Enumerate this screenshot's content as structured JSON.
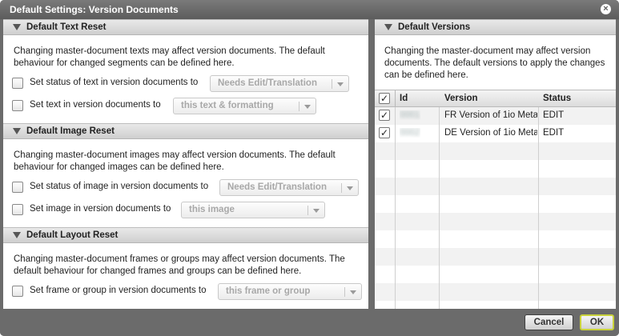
{
  "dialog": {
    "title": "Default Settings: Version Documents"
  },
  "text_reset": {
    "header": "Default Text Reset",
    "description_1": "Changing master-document texts may affect version documents. The default",
    "description_2": "behaviour for changed segments can be defined here.",
    "row1_label": "Set status of text in version documents to",
    "row1_value": "Needs Edit/Translation",
    "row2_label": "Set text in version documents to",
    "row2_value": "this text & formatting"
  },
  "image_reset": {
    "header": "Default Image Reset",
    "description_1": "Changing master-document images may affect version documents. The default",
    "description_2": "behaviour for changed images can be defined here.",
    "row1_label": "Set status of image in version documents to",
    "row1_value": "Needs Edit/Translation",
    "row2_label": "Set image in version documents to",
    "row2_value": "this image"
  },
  "layout_reset": {
    "header": "Default Layout Reset",
    "description_1": "Changing master-document frames or groups may affect version documents. The",
    "description_2": "default behaviour for changed frames and groups can be defined here.",
    "row1_label": "Set frame or group in version documents to",
    "row1_value": "this frame or group"
  },
  "versions": {
    "header": "Default Versions",
    "description_1": "Changing the master-document may affect version",
    "description_2": "documents. The default versions to apply the changes",
    "description_3": "can be defined here.",
    "columns": {
      "id": "Id",
      "version": "Version",
      "status": "Status"
    },
    "rows": [
      {
        "id": "0001",
        "version": "FR Version of 1io Meta",
        "status": "EDIT",
        "checked": true
      },
      {
        "id": "0002",
        "version": "DE Version of 1io Meta",
        "status": "EDIT",
        "checked": true
      }
    ]
  },
  "footer": {
    "cancel_label": "Cancel",
    "ok_label": "OK"
  },
  "icons": {
    "close": "close-icon",
    "collapse": "triangle-down-icon",
    "dropdown": "chevron-down-icon",
    "check": "✓"
  }
}
